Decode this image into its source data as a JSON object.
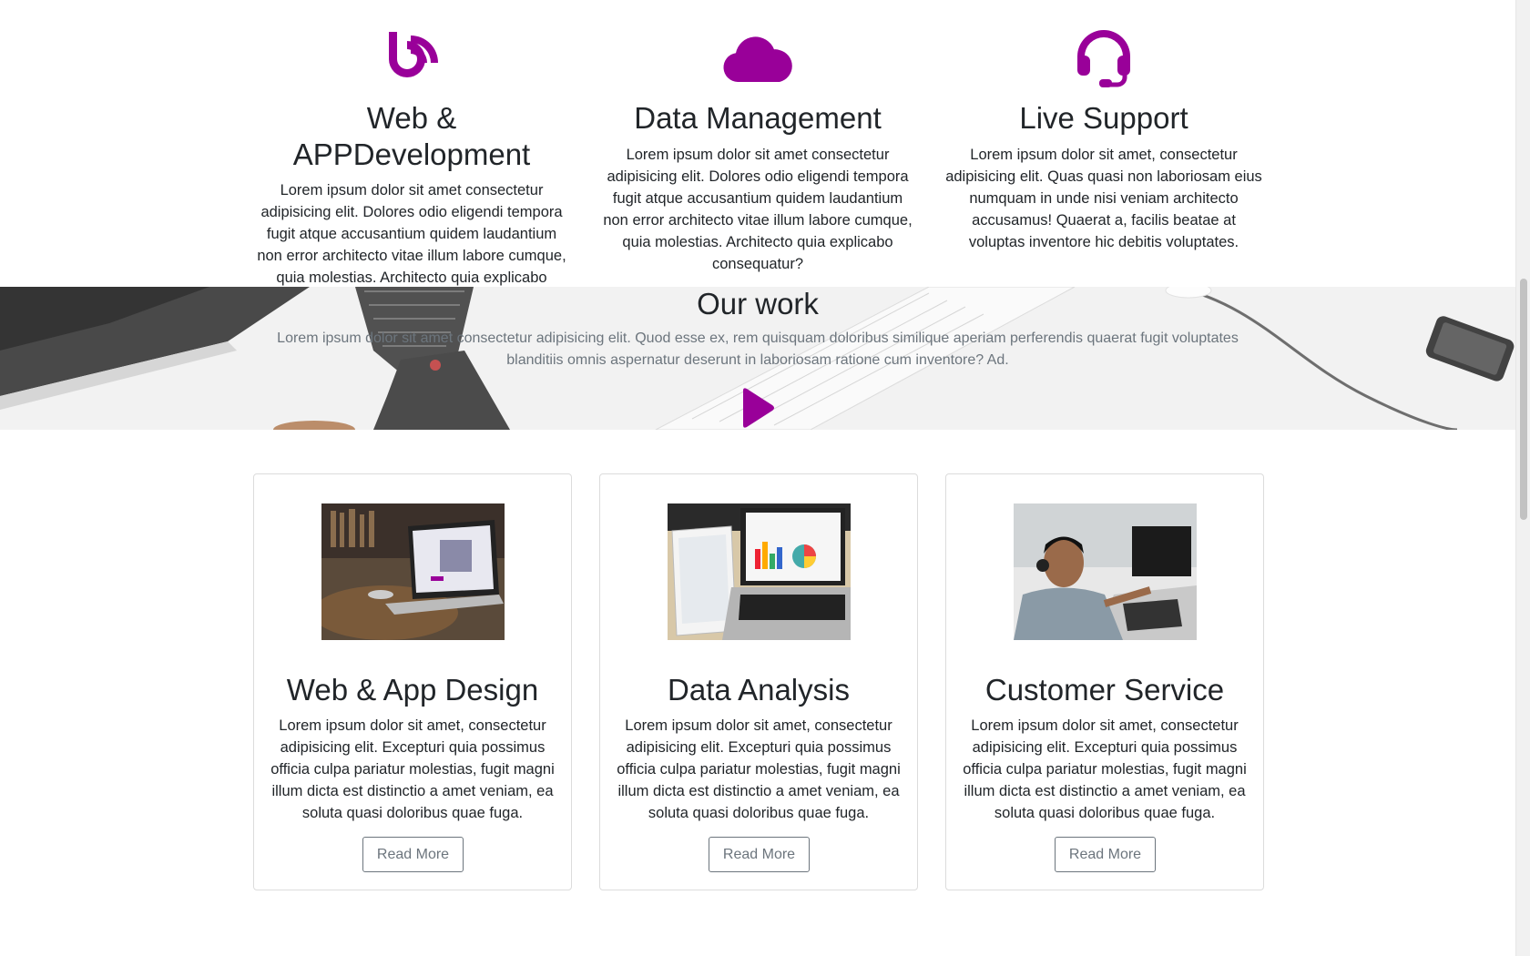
{
  "colors": {
    "accent": "#990099",
    "text": "#212529",
    "muted": "#6c757d"
  },
  "features": [
    {
      "icon": "blog-feed-icon",
      "title": "Web & APPDevelopment",
      "text": "Lorem ipsum dolor sit amet consectetur adipisicing elit. Dolores odio eligendi tempora fugit atque accusantium quidem laudantium non error architecto vitae illum labore cumque, quia molestias. Architecto quia explicabo consequatur?"
    },
    {
      "icon": "cloud-icon",
      "title": "Data Management",
      "text": "Lorem ipsum dolor sit amet consectetur adipisicing elit. Dolores odio eligendi tempora fugit atque accusantium quidem laudantium non error architecto vitae illum labore cumque, quia molestias. Architecto quia explicabo consequatur?"
    },
    {
      "icon": "headset-icon",
      "title": "Live Support",
      "text": "Lorem ipsum dolor sit amet, consectetur adipisicing elit. Quas quasi non laboriosam eius numquam in unde nisi veniam architecto accusamus! Quaerat a, facilis beatae at voluptas inventore hic debitis voluptates."
    }
  ],
  "our_work": {
    "title": "Our work",
    "text": "Lorem ipsum dolor sit amet consectetur adipisicing elit. Quod esse ex, rem quisquam doloribus similique aperiam perferendis quaerat fugit voluptates blanditiis omnis aspernatur deserunt in laboriosam ratione cum inventore? Ad.",
    "play_icon": "play-icon"
  },
  "cards": [
    {
      "image": "laptop-on-desk-photo",
      "title": "Web & App Design",
      "text": "Lorem ipsum dolor sit amet, consectetur adipisicing elit. Excepturi quia possimus officia culpa pariatur molestias, fugit magni illum dicta est distinctio a amet veniam, ea soluta quasi doloribus quae fuga.",
      "button": "Read More"
    },
    {
      "image": "laptop-charts-photo",
      "title": "Data Analysis",
      "text": "Lorem ipsum dolor sit amet, consectetur adipisicing elit. Excepturi quia possimus officia culpa pariatur molestias, fugit magni illum dicta est distinctio a amet veniam, ea soluta quasi doloribus quae fuga.",
      "button": "Read More"
    },
    {
      "image": "support-agent-photo",
      "title": "Customer Service",
      "text": "Lorem ipsum dolor sit amet, consectetur adipisicing elit. Excepturi quia possimus officia culpa pariatur molestias, fugit magni illum dicta est distinctio a amet veniam, ea soluta quasi doloribus quae fuga.",
      "button": "Read More"
    }
  ]
}
